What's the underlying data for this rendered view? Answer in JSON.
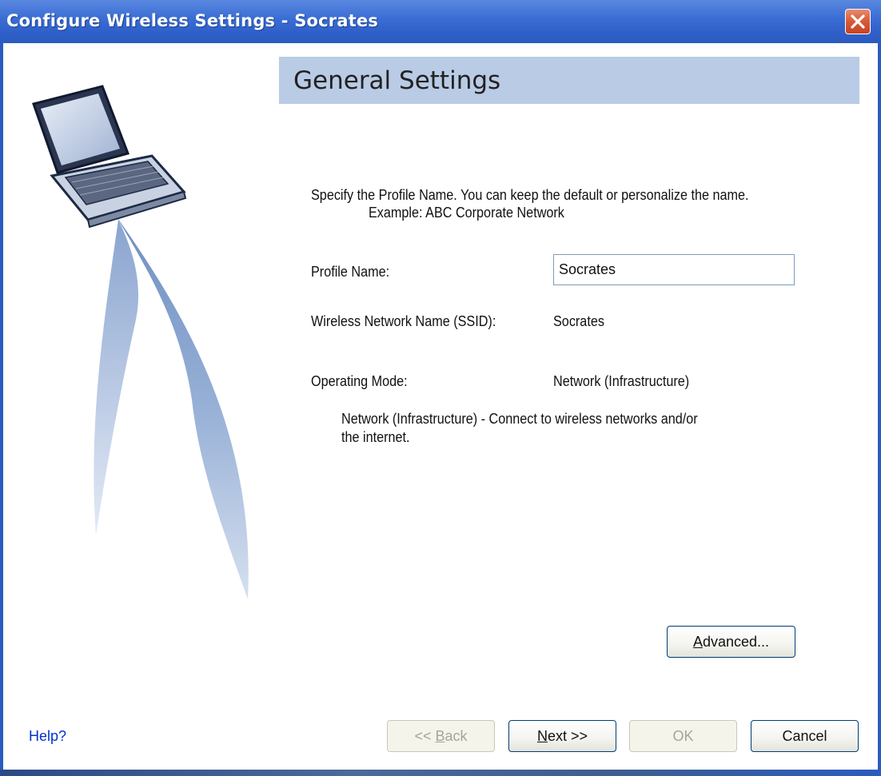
{
  "window": {
    "title": "Configure Wireless Settings - Socrates",
    "close_icon": "close-icon"
  },
  "header": {
    "title": "General Settings"
  },
  "instructions": {
    "line1": "Specify the Profile Name. You can keep the default or personalize the name.",
    "line2": "Example: ABC Corporate Network"
  },
  "fields": {
    "profile_name_label": "Profile Name:",
    "profile_name_value": "Socrates",
    "ssid_label": "Wireless Network Name (SSID):",
    "ssid_value": "Socrates",
    "mode_label": "Operating Mode:",
    "mode_value": "Network (Infrastructure)",
    "mode_description_line1": "Network (Infrastructure) - Connect to wireless networks and/or",
    "mode_description_line2": "the internet."
  },
  "buttons": {
    "advanced_prefix": "A",
    "advanced_rest": "dvanced...",
    "back_prefix": "<< ",
    "back_accel": "B",
    "back_rest": "ack",
    "back_enabled": false,
    "next_accel": "N",
    "next_rest": "ext >>",
    "ok": "OK",
    "ok_enabled": false,
    "cancel": "Cancel"
  },
  "help": {
    "label": "Help?"
  },
  "colors": {
    "titlebar": "#3c6fd5",
    "header_band": "#b9cbe5",
    "link": "#0033cc",
    "close_button": "#d75a35"
  }
}
